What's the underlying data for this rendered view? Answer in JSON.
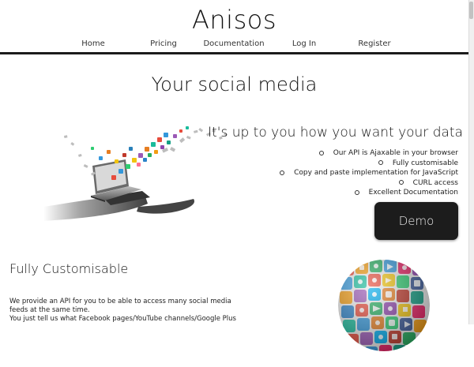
{
  "site": {
    "brand": "Anisos"
  },
  "nav": {
    "items": [
      {
        "label": "Home"
      },
      {
        "label": "Pricing"
      },
      {
        "label": "Documentation"
      },
      {
        "label": "Log In"
      },
      {
        "label": "Register"
      }
    ]
  },
  "hero": {
    "title": "Your social media"
  },
  "features": {
    "subtitle": "It's up to you how you want your data",
    "items": [
      "Our API is Ajaxable in your browser",
      "Fully customisable",
      "Copy and paste implementation for JavaScript",
      "CURL access",
      "Excellent Documentation"
    ],
    "demo_label": "Demo"
  },
  "section": {
    "title": "Fully Customisable",
    "lines": [
      "We provide an API for you to be able to access many social media feeds at the same time.",
      "You just tell us what Facebook pages/YouTube channels/Google Plus"
    ]
  },
  "colors": {
    "nav_rule": "#1b1b1b",
    "demo_bg": "#1c1c1c",
    "demo_text": "#f2f2f2"
  }
}
